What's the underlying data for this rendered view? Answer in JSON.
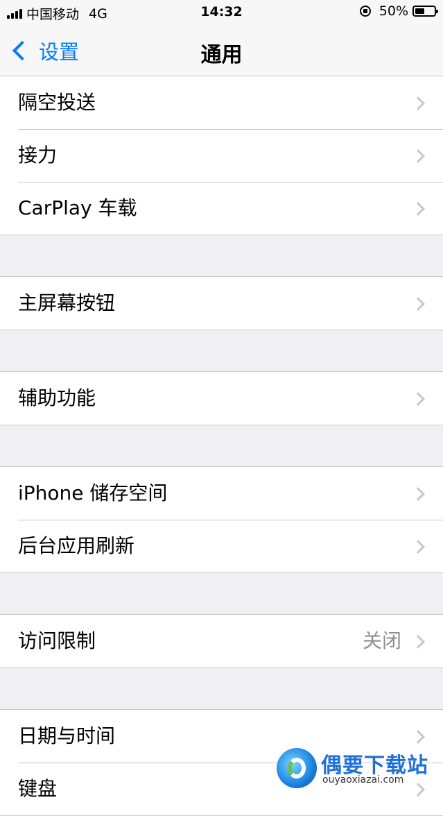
{
  "status_bar": {
    "carrier": "中国移动",
    "network": "4G",
    "time": "14:32",
    "battery_percent": "50%",
    "battery_level": 0.5
  },
  "nav": {
    "back_label": "设置",
    "title": "通用"
  },
  "groups": [
    {
      "rows": [
        {
          "label": "隔空投送"
        },
        {
          "label": "接力"
        },
        {
          "label": "CarPlay 车载"
        }
      ]
    },
    {
      "rows": [
        {
          "label": "主屏幕按钮"
        }
      ]
    },
    {
      "rows": [
        {
          "label": "辅助功能"
        }
      ]
    },
    {
      "rows": [
        {
          "label": "iPhone 储存空间"
        },
        {
          "label": "后台应用刷新"
        }
      ]
    },
    {
      "rows": [
        {
          "label": "访问限制",
          "detail": "关闭"
        }
      ]
    },
    {
      "rows": [
        {
          "label": "日期与时间"
        },
        {
          "label": "键盘"
        }
      ]
    }
  ],
  "watermark": {
    "title": "偶要下载站",
    "url": "ouyaoxiazai.com"
  },
  "colors": {
    "accent": "#007aff",
    "background": "#efeff4",
    "separator": "#c8c7cc",
    "detail_text": "#8e8e93"
  }
}
